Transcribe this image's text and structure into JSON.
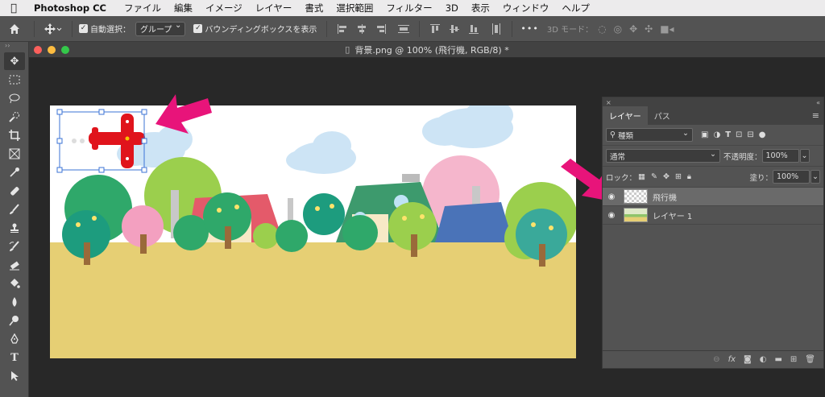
{
  "menubar": {
    "app_name": "Photoshop CC",
    "items": [
      "ファイル",
      "編集",
      "イメージ",
      "レイヤー",
      "書式",
      "選択範囲",
      "フィルター",
      "3D",
      "表示",
      "ウィンドウ",
      "ヘルプ"
    ]
  },
  "options": {
    "auto_select_label": "自動選択：",
    "auto_select_value": "グループ",
    "bbox_label": "バウンディングボックスを表示",
    "more": "•••",
    "mode_3d_label": "3D モード："
  },
  "document": {
    "title": "背景.png @ 100% (飛行機, RGB/8) *"
  },
  "layers_panel": {
    "collapse": "× ",
    "expand": "«",
    "tabs": [
      "レイヤー",
      "パス"
    ],
    "filter_kind": "種類",
    "blend_mode": "通常",
    "opacity_label": "不透明度：",
    "opacity_value": "100%",
    "lock_label": "ロック：",
    "fill_label": "塗り：",
    "fill_value": "100%",
    "layers": [
      {
        "name": "飛行機",
        "selected": true
      },
      {
        "name": "レイヤー 1",
        "selected": false
      }
    ],
    "bottom_icons": [
      "link-icon",
      "fx-icon",
      "mask-icon",
      "adjustment-icon",
      "folder-icon",
      "new-layer-icon",
      "trash-icon"
    ],
    "fx_label": "fx"
  },
  "colors": {
    "arrow": "#e8147a",
    "ground": "#e6cf74",
    "plane": "#e0141c",
    "sky_cloud": "#cde4f5"
  }
}
